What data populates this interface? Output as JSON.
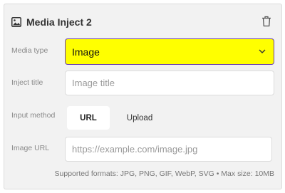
{
  "header": {
    "title": "Media Inject 2",
    "icon": "image-icon",
    "delete_icon": "trash-icon"
  },
  "fields": {
    "media_type": {
      "label": "Media type",
      "selected": "Image",
      "highlight_color": "#ffff00",
      "border_color": "#6a3fb0"
    },
    "inject_title": {
      "label": "Inject title",
      "value": "",
      "placeholder": "Image title"
    },
    "input_method": {
      "label": "Input method",
      "options": [
        "URL",
        "Upload"
      ],
      "selected": "URL"
    },
    "image_url": {
      "label": "Image URL",
      "value": "",
      "placeholder": "https://example.com/image.jpg"
    }
  },
  "hint": "Supported formats: JPG, PNG, GIF, WebP, SVG • Max size: 10MB"
}
